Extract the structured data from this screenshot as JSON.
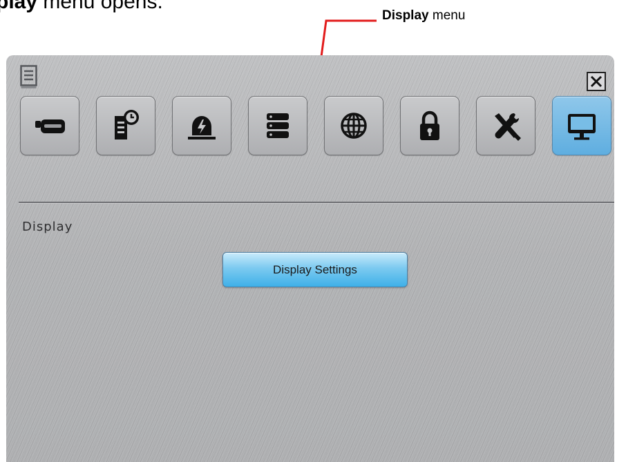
{
  "doc": {
    "caption_bold": "play",
    "caption_rest": " menu opens.",
    "callout_bold": "Display",
    "callout_rest": " menu"
  },
  "colors": {
    "callout": "#e21b1b",
    "accent": "#5faee0"
  },
  "toolbar": {
    "menu_icon": "document-list-icon",
    "close_icon": "close-icon"
  },
  "tabs": [
    {
      "icon": "device-icon",
      "active": false
    },
    {
      "icon": "schedule-log-icon",
      "active": false
    },
    {
      "icon": "alarm-icon",
      "active": false
    },
    {
      "icon": "storage-icon",
      "active": false
    },
    {
      "icon": "network-globe-icon",
      "active": false
    },
    {
      "icon": "lock-icon",
      "active": false
    },
    {
      "icon": "tools-icon",
      "active": false
    },
    {
      "icon": "display-monitor-icon",
      "active": true
    }
  ],
  "section": {
    "title": "Display",
    "button_label": "Display Settings"
  }
}
